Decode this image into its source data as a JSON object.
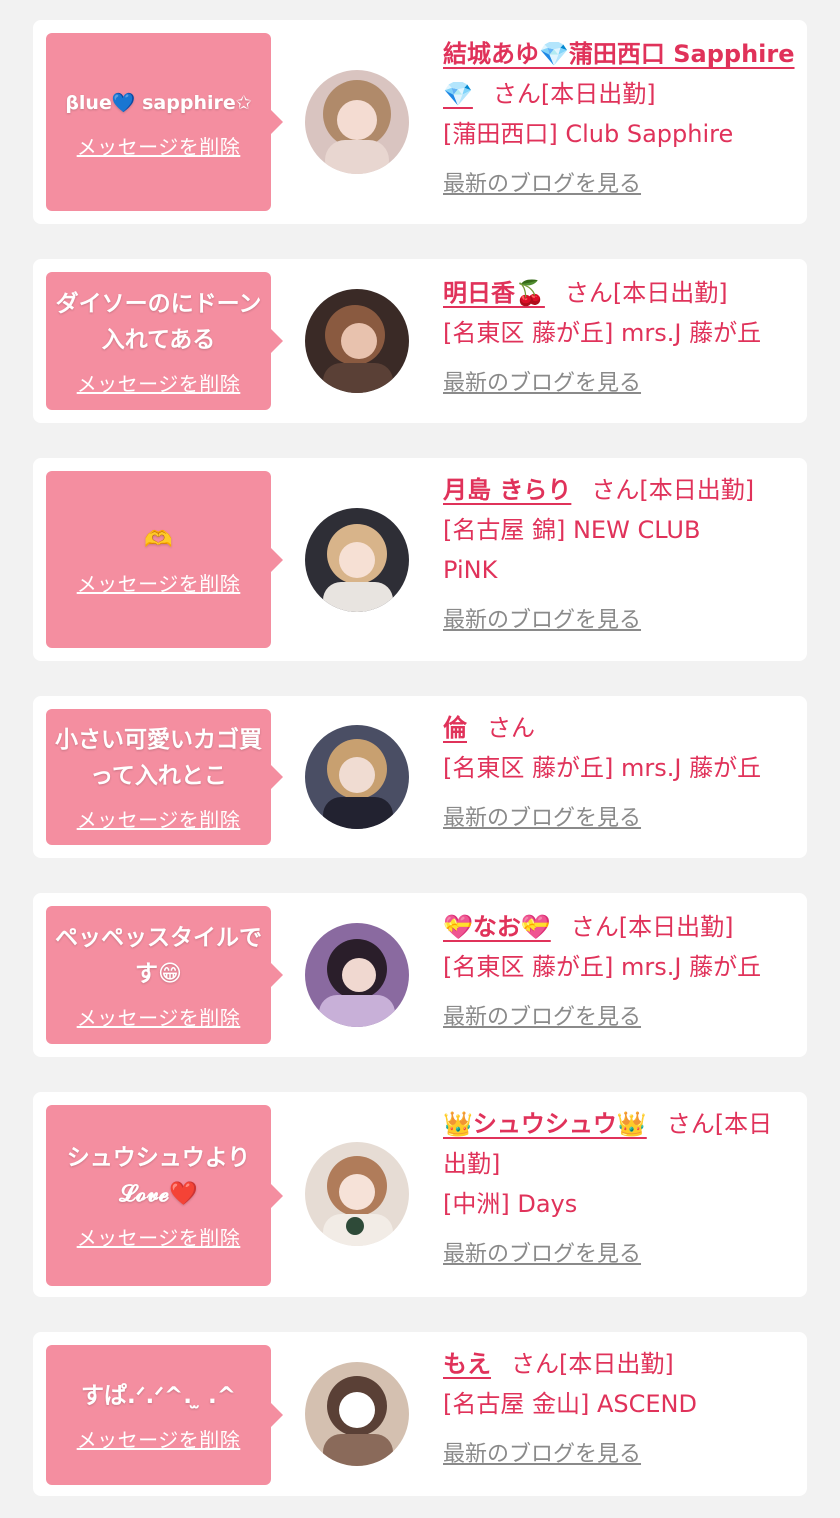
{
  "messages": [
    {
      "message": "βlue💙 sapphire✩",
      "delete_label": "メッセージを削除",
      "name": "結城あゆ💎蒲田西口 Sapphire💎",
      "san_status": "さん[本日出勤]",
      "shop": "[蒲田西口] Club Sapphire",
      "blog_label": "最新のブログを見る"
    },
    {
      "message": "ダイソーのにドーン入れてある",
      "delete_label": "メッセージを削除",
      "name": "明日香🍒",
      "san_status": "さん[本日出勤]",
      "shop": "[名東区 藤が丘] mrs.J 藤が丘",
      "blog_label": "最新のブログを見る"
    },
    {
      "message": "🫶",
      "delete_label": "メッセージを削除",
      "name": "月島 きらり",
      "san_status": "さん[本日出勤]",
      "shop": "[名古屋 錦] NEW CLUB PiNK",
      "blog_label": "最新のブログを見る"
    },
    {
      "message": "小さい可愛いカゴ買って入れとこ",
      "delete_label": "メッセージを削除",
      "name": "倫",
      "san_status": "さん",
      "shop": "[名東区 藤が丘] mrs.J 藤が丘",
      "blog_label": "最新のブログを見る"
    },
    {
      "message": "ペッペッスタイルです😁",
      "delete_label": "メッセージを削除",
      "name": "💝なお💝",
      "san_status": "さん[本日出勤]",
      "shop": "[名東区 藤が丘] mrs.J 藤が丘",
      "blog_label": "最新のブログを見る"
    },
    {
      "message": "シュウシュウより 𝓛𝓸𝓿𝓮❤️",
      "delete_label": "メッセージを削除",
      "name": "👑シュウシュウ👑",
      "san_status": "さん[本日出勤]",
      "shop": "[中洲] Days",
      "blog_label": "最新のブログを見る"
    },
    {
      "message": "すぱ.ᐟ.ᐟ^. ̫ .^",
      "delete_label": "メッセージを削除",
      "name": "もえ",
      "san_status": "さん[本日出勤]",
      "shop": "[名古屋 金山] ASCEND",
      "blog_label": "最新のブログを見る"
    }
  ],
  "colors": {
    "page_bg": "#f2f2f2",
    "bubble_pink": "#f48ea0",
    "name_red": "#e0325a",
    "link_gray": "#8a8a8a"
  },
  "icons": {
    "avatar": "profile-photo"
  }
}
